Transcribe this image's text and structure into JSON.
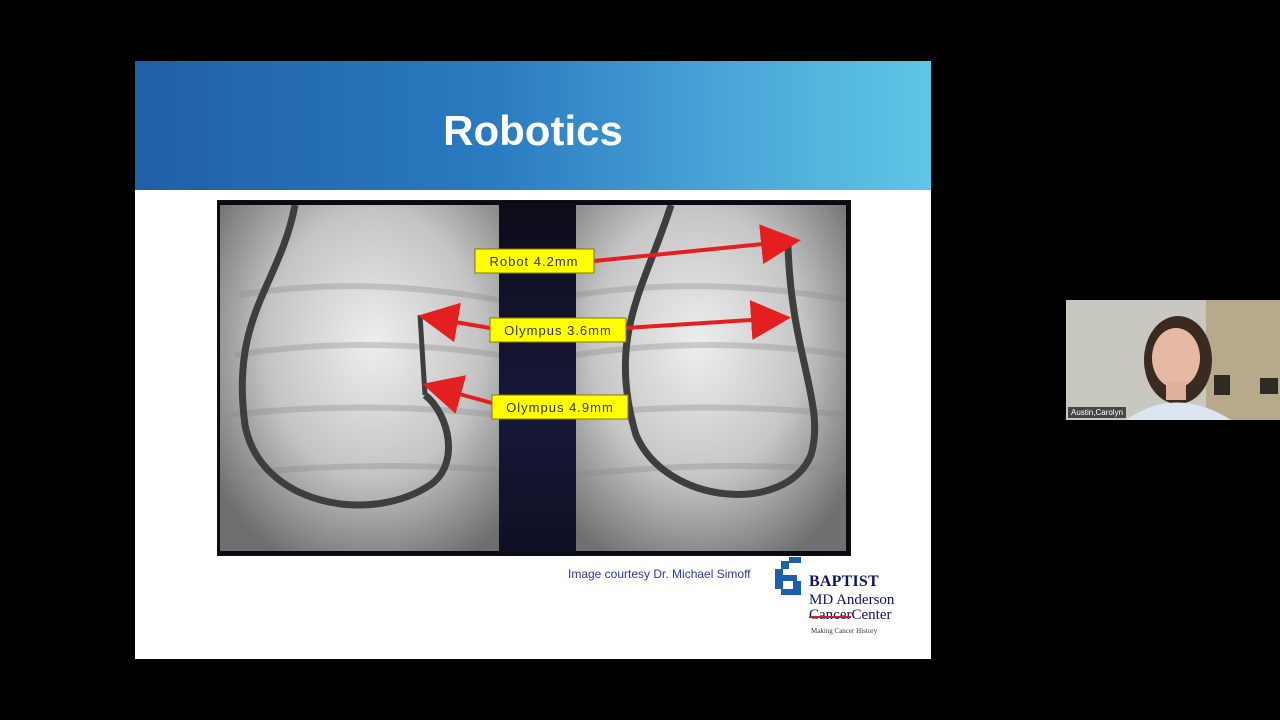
{
  "slide": {
    "title": "Robotics",
    "labels": {
      "robot": "Robot 4.2mm",
      "olympus_36": "Olympus 3.6mm",
      "olympus_49": "Olympus 4.9mm"
    },
    "caption": "Image courtesy Dr. Michael Simoff",
    "logo": {
      "line1": "BAPTIST",
      "line2": "MD Anderson",
      "line3_strike": "Cancer",
      "line3_rest": "Center",
      "tagline": "Making Cancer History"
    }
  },
  "participant": {
    "name": "Austin,Carolyn"
  },
  "colors": {
    "header_start": "#1f5fa8",
    "header_end": "#5fc6e6",
    "label_bg": "#ffff00",
    "arrow": "#e41f1f",
    "caption": "#2b3a9e"
  }
}
